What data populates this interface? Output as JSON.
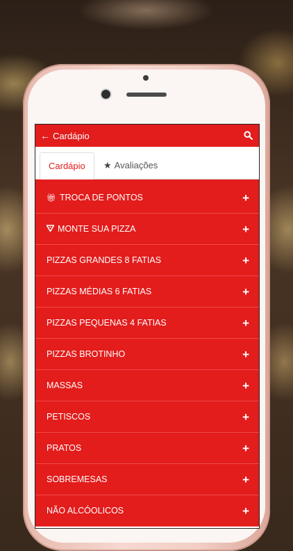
{
  "header": {
    "title": "Cardápio",
    "back_icon": "arrow-left-icon",
    "search_icon": "search-icon"
  },
  "tabs": [
    {
      "label": "Cardápio",
      "active": true
    },
    {
      "label": "Avaliações",
      "icon": "star-icon"
    }
  ],
  "menu": [
    {
      "label": "TROCA DE PONTOS",
      "icon": "gift-icon"
    },
    {
      "label": "MONTE SUA PIZZA",
      "icon": "pizza-slice-icon"
    },
    {
      "label": "PIZZAS GRANDES 8 FATIAS"
    },
    {
      "label": "PIZZAS MÉDIAS 6 FATIAS"
    },
    {
      "label": "PIZZAS PEQUENAS 4 FATIAS"
    },
    {
      "label": "PIZZAS BROTINHO"
    },
    {
      "label": "MASSAS"
    },
    {
      "label": "PETISCOS"
    },
    {
      "label": "PRATOS"
    },
    {
      "label": "SOBREMESAS"
    },
    {
      "label": "NÃO ALCÓOLICOS"
    }
  ],
  "expand_symbol": "+",
  "colors": {
    "accent": "#e31c1c",
    "text_on_accent": "#ffffff"
  }
}
